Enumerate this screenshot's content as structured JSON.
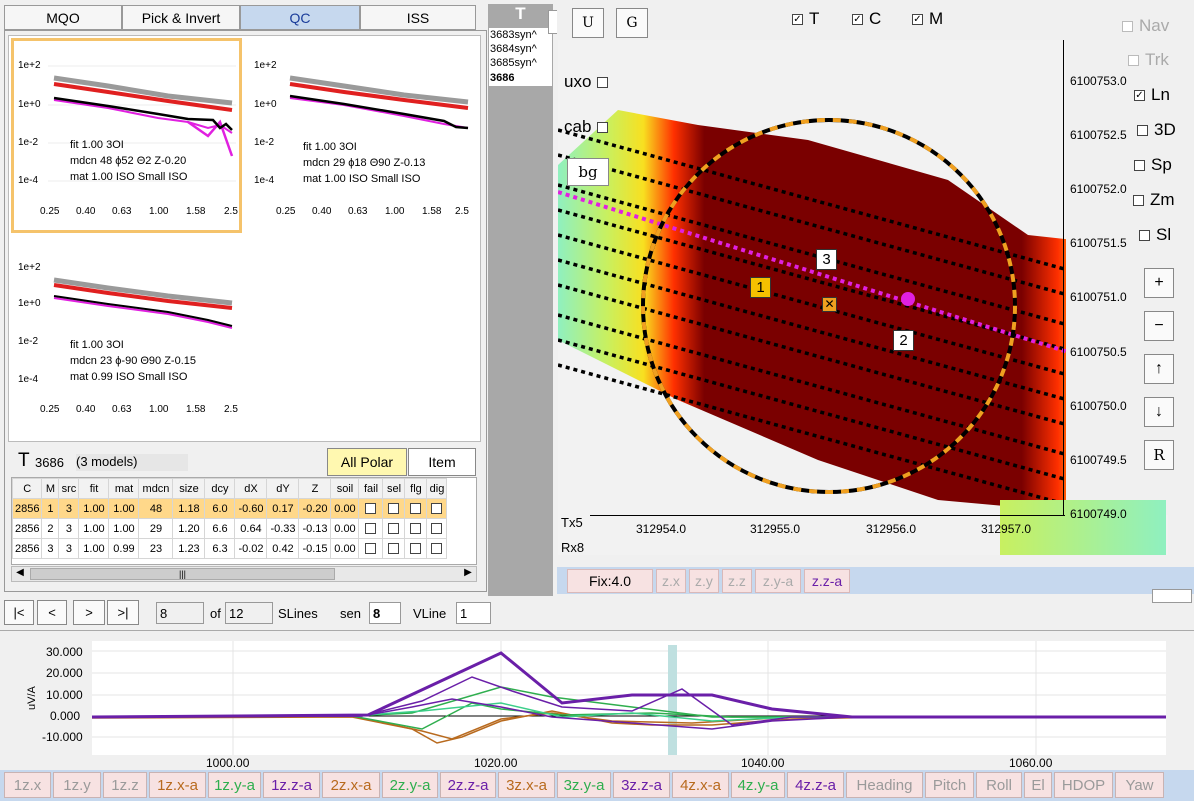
{
  "tabs": [
    "MQO",
    "Pick & Invert",
    "QC",
    "ISS"
  ],
  "active_tab": "QC",
  "plots": [
    {
      "yticks": [
        "1e+2",
        "1e+0",
        "1e-2",
        "1e-4"
      ],
      "xticks": [
        "0.25",
        "0.40",
        "0.63",
        "1.00",
        "1.58",
        "2.5"
      ],
      "line1": "fit 1.00  3OI",
      "line2": "mdcn 48  ϕ52  Θ2  Z-0.20",
      "line3": "mat 1.00  ISO Small ISO"
    },
    {
      "yticks": [
        "1e+2",
        "1e+0",
        "1e-2",
        "1e-4"
      ],
      "xticks": [
        "0.25",
        "0.40",
        "0.63",
        "1.00",
        "1.58",
        "2.5"
      ],
      "line1": "fit 1.00  3OI",
      "line2": "mdcn 29  ϕ18  Θ90  Z-0.13",
      "line3": "mat 1.00  ISO Small ISO"
    },
    {
      "yticks": [
        "1e+2",
        "1e+0",
        "1e-2",
        "1e-4"
      ],
      "xticks": [
        "0.25",
        "0.40",
        "0.63",
        "1.00",
        "1.58",
        "2.5"
      ],
      "line1": "fit 1.00  3OI",
      "line2": "mdcn 23  ϕ-90  Θ90  Z-0.15",
      "line3": "mat 0.99  ISO Small ISO"
    }
  ],
  "target": {
    "letter": "T",
    "id": "3686",
    "models": "(3 models)"
  },
  "buttons": {
    "all_polar": "All Polar",
    "item": "Item"
  },
  "table": {
    "headers": [
      "C",
      "M",
      "src",
      "fit",
      "mat",
      "mdcn",
      "size",
      "dcy",
      "dX",
      "dY",
      "Z",
      "soil",
      "fail",
      "sel",
      "flg",
      "dig"
    ],
    "rows": [
      [
        "2856",
        "1",
        "3",
        "1.00",
        "1.00",
        "48",
        "1.18",
        "6.0",
        "-0.60",
        "0.17",
        "-0.20",
        "0.00"
      ],
      [
        "2856",
        "2",
        "3",
        "1.00",
        "1.00",
        "29",
        "1.20",
        "6.6",
        "0.64",
        "-0.33",
        "-0.13",
        "0.00"
      ],
      [
        "2856",
        "3",
        "3",
        "1.00",
        "0.99",
        "23",
        "1.23",
        "6.3",
        "-0.02",
        "0.42",
        "-0.15",
        "0.00"
      ]
    ]
  },
  "target_list": {
    "header": "T",
    "items": [
      "3683syn^",
      "3684syn^",
      "3685syn^",
      "3686"
    ]
  },
  "map": {
    "btn_u": "U",
    "btn_g": "G",
    "toggles": [
      {
        "label": "T",
        "checked": true
      },
      {
        "label": "C",
        "checked": true
      },
      {
        "label": "M",
        "checked": true
      }
    ],
    "overlays": [
      {
        "label": "uxo"
      },
      {
        "label": "cab"
      }
    ],
    "bg_label": "bg",
    "right_options": [
      {
        "label": "Nav",
        "checked": false,
        "disabled": true
      },
      {
        "label": "Trk",
        "checked": false,
        "disabled": true
      },
      {
        "label": "Ln",
        "checked": true,
        "disabled": false
      },
      {
        "label": "3D",
        "checked": false,
        "disabled": false
      },
      {
        "label": "Sp",
        "checked": false,
        "disabled": false
      },
      {
        "label": "Zm",
        "checked": false,
        "disabled": false
      },
      {
        "label": "Sl",
        "checked": false,
        "disabled": false
      }
    ],
    "nav_buttons": [
      "+",
      "−",
      "↑",
      "↓",
      "R"
    ],
    "y_ticks": [
      "6100753.0",
      "6100752.5",
      "6100752.0",
      "6100751.5",
      "6100751.0",
      "6100750.5",
      "6100750.0",
      "6100749.5",
      "6100749.0"
    ],
    "x_ticks": [
      "312954.0",
      "312955.0",
      "312956.0",
      "312957.0"
    ],
    "markers": [
      "1",
      "2",
      "3"
    ],
    "tx_label": "Tx5",
    "rx_label": "Rx8",
    "fix_label": "Fix:4.0",
    "comp_chips": [
      "z.x",
      "z.y",
      "z.z",
      "z.y-a",
      "z.z-a"
    ]
  },
  "nav_bar": {
    "buttons": [
      "|<",
      "<",
      ">",
      ">|"
    ],
    "current": "8",
    "of_label": "of",
    "total": "12",
    "slines_label": "SLines",
    "sen_label": "sen",
    "sen_value": "8",
    "vline_label": "VLine",
    "vline_value": "1"
  },
  "bottom_chart": {
    "ylabel": "uV/A",
    "yticks": [
      "30.000",
      "20.000",
      "10.000",
      "0.000",
      "-10.000"
    ],
    "xticks": [
      "1000.00",
      "1020.00",
      "1040.00",
      "1060.00"
    ]
  },
  "channels": [
    {
      "label": "1z.x",
      "color": "#888888"
    },
    {
      "label": "1z.y",
      "color": "#888888"
    },
    {
      "label": "1z.z",
      "color": "#888888"
    },
    {
      "label": "1z.x-a",
      "color": "#b86a1e"
    },
    {
      "label": "1z.y-a",
      "color": "#2fae4e"
    },
    {
      "label": "1z.z-a",
      "color": "#6a1fa8"
    },
    {
      "label": "2z.x-a",
      "color": "#b86a1e"
    },
    {
      "label": "2z.y-a",
      "color": "#2fae4e"
    },
    {
      "label": "2z.z-a",
      "color": "#6a1fa8"
    },
    {
      "label": "3z.x-a",
      "color": "#b86a1e"
    },
    {
      "label": "3z.y-a",
      "color": "#2fae4e"
    },
    {
      "label": "3z.z-a",
      "color": "#6a1fa8"
    },
    {
      "label": "4z.x-a",
      "color": "#b86a1e"
    },
    {
      "label": "4z.y-a",
      "color": "#2fae4e"
    },
    {
      "label": "4z.z-a",
      "color": "#6a1fa8"
    },
    {
      "label": "Heading",
      "color": "#888888"
    },
    {
      "label": "Pitch",
      "color": "#888888"
    },
    {
      "label": "Roll",
      "color": "#888888"
    },
    {
      "label": "El",
      "color": "#888888"
    },
    {
      "label": "HDOP",
      "color": "#888888"
    },
    {
      "label": "Yaw",
      "color": "#888888"
    }
  ],
  "colors": {
    "accent": "#1a3c9a",
    "highlight_row": "#ffd88a",
    "anomaly": "#7a0000",
    "magenta": "#e020e0",
    "orange": "#f0a020"
  }
}
